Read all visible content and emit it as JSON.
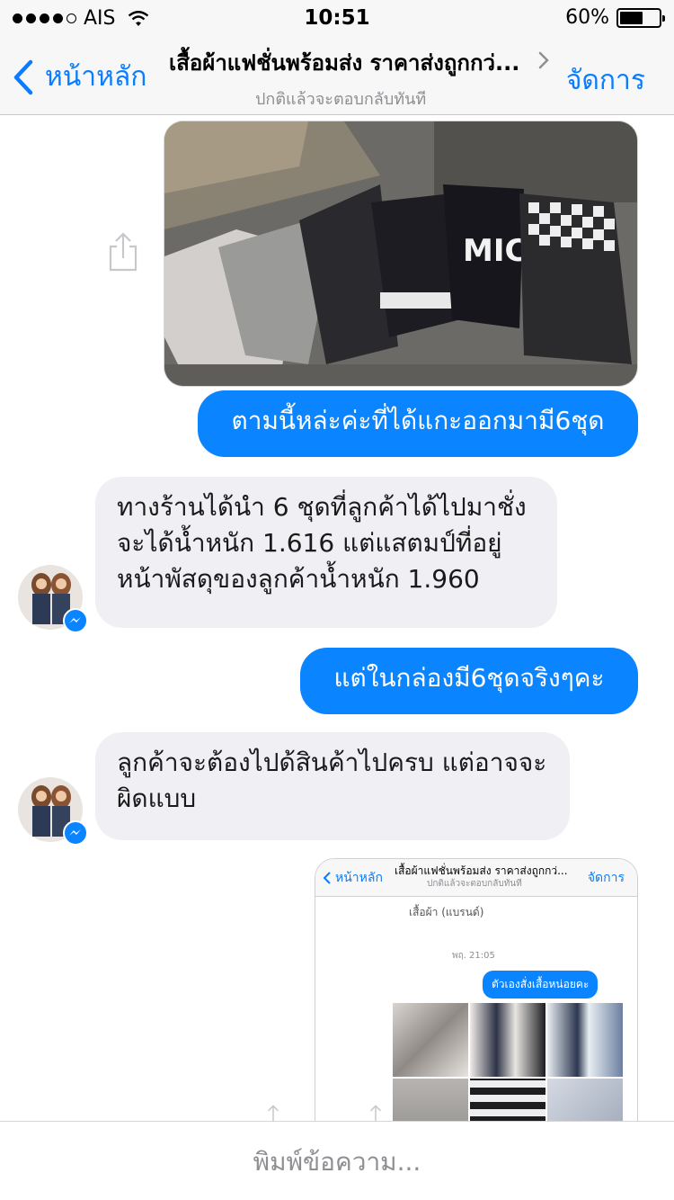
{
  "status_bar": {
    "carrier": "AIS",
    "time": "10:51",
    "battery_percent": "60%",
    "battery_level": 0.6,
    "signal_bars": 4
  },
  "nav": {
    "back_label": "หน้าหลัก",
    "title": "เสื้อผ้าแฟชั่นพร้อมส่ง ราคาส่งถูกกว่...",
    "subtitle": "ปกติแล้วจะตอบกลับทันที",
    "manage_label": "จัดการ"
  },
  "messages": [
    {
      "sender": "me",
      "text": "ตามนี้หล่ะค่ะที่ได้แกะออกมามี6ชุด"
    },
    {
      "sender": "shop",
      "text": "ทางร้านได้นำ 6 ชุดที่ลูกค้าได้ไปมาชั่ง จะได้น้ำหนัก 1.616 แต่แสตมป์ที่อยู่หน้าพัสดุของลูกค้าน้ำหนัก 1.960"
    },
    {
      "sender": "me",
      "text": "แต่ในกล่องมี6ชุดจริงๆคะ"
    },
    {
      "sender": "shop",
      "text": "ลูกค้าจะต้องไปด้สินค้าไปครบ แต่อาจจะผิดแบบ"
    }
  ],
  "embedded_screenshot": {
    "back_label": "หน้าหลัก",
    "title": "เสื้อผ้าแฟชั่นพร้อมส่ง ราคาส่งถูกกว่...",
    "subtitle": "ปกติแล้วจะตอบกลับทันที",
    "manage_label": "จัดการ",
    "contact": "เสื้อผ้า (แบรนด์)",
    "time": "พฤ. 21:05",
    "message": "ตัวเองสั่งเสื้อหน่อยคะ"
  },
  "input": {
    "placeholder": "พิมพ์ข้อความ..."
  },
  "colors": {
    "accent": "#0a7cff",
    "outgoing_bubble": "#0a84ff",
    "incoming_bubble": "#efeff4",
    "bar_bg": "#f7f7f7"
  }
}
